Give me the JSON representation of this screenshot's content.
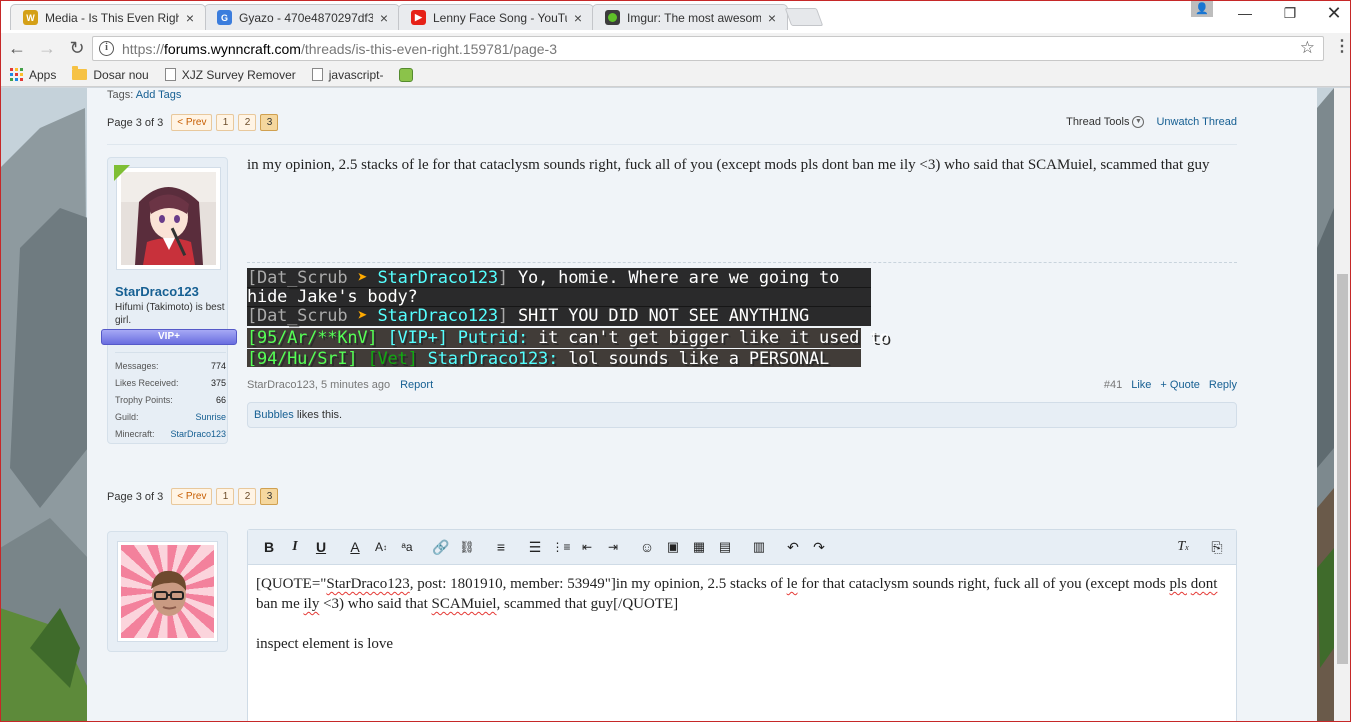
{
  "browser": {
    "tabs": [
      {
        "title": "Media - Is This Even Righ",
        "active": true,
        "favicon_color": "#d4a017"
      },
      {
        "title": "Gyazo - 470e4870297df3",
        "active": false,
        "favicon_color": "#3b7ddd"
      },
      {
        "title": "Lenny Face Song - YouTu",
        "active": false,
        "favicon_color": "#e62117"
      },
      {
        "title": "Imgur: The most awesom",
        "active": false,
        "favicon_color": "#5e9e34"
      }
    ],
    "url": {
      "scheme": "https://",
      "host": "forums.wynncraft.com",
      "path": "/threads/is-this-even-right.159781/page-3"
    },
    "bookmarks": [
      {
        "label": "Apps",
        "icon": "apps-grid-icon"
      },
      {
        "label": "Dosar nou",
        "icon": "folder-icon"
      },
      {
        "label": "XJZ Survey Remover",
        "icon": "document-icon"
      },
      {
        "label": "javascript-",
        "icon": "document-icon"
      },
      {
        "label": "",
        "icon": "extension-icon"
      }
    ]
  },
  "thread": {
    "tags_label": "Tags:",
    "add_tags": "Add Tags",
    "page_label": "Page 3 of 3",
    "prev_label": "< Prev",
    "pages": [
      "1",
      "2",
      "3"
    ],
    "current_page": "3",
    "thread_tools": "Thread Tools",
    "unwatch": "Unwatch Thread"
  },
  "post": {
    "username": "StarDraco123",
    "user_title": "Hifumi (Takimoto) is best girl.",
    "rank_badge": "VIP+",
    "stats": [
      {
        "label": "Messages:",
        "value": "774",
        "link": false
      },
      {
        "label": "Likes Received:",
        "value": "375",
        "link": false
      },
      {
        "label": "Trophy Points:",
        "value": "66",
        "link": false
      },
      {
        "label": "Guild:",
        "value": "Sunrise",
        "link": true
      },
      {
        "label": "Minecraft:",
        "value": "StarDraco123",
        "link": true
      }
    ],
    "text": "in my opinion, 2.5 stacks of le for that cataclysm sounds right, fuck all of you (except mods pls dont ban me ily <3) who said that SCAMuiel, scammed that guy",
    "chat_lines": {
      "l1_open": "[Dat_Scrub",
      "l1_arrow": "➤",
      "l1_target": "StarDraco123",
      "l1_close": "]",
      "l1_msg": "Yo, homie. Where are we going to",
      "l2_msg": "hide Jake's body?",
      "l3_open": "[Dat_Scrub",
      "l3_arrow": "➤",
      "l3_target": "StarDraco123",
      "l3_close": "]",
      "l3_msg": "SHIT YOU DID NOT SEE ANYTHING",
      "l4_tag": "[95/Ar/**KnV]",
      "l4_rank": "[VIP+]",
      "l4_name": "Putrid:",
      "l4_msg": "it can't get bigger like it used to",
      "l5_tag": "[94/Hu/SrI]",
      "l5_rank": "[Vet]",
      "l5_name": "StarDraco123:",
      "l5_msg": "lol sounds like a PERSONAL"
    },
    "meta_author": "StarDraco123",
    "meta_time": "5 minutes ago",
    "report": "Report",
    "post_number": "#41",
    "like": "Like",
    "quote": "+ Quote",
    "reply": "Reply",
    "likes_user": "Bubbles",
    "likes_suffix": "likes this."
  },
  "reply_editor": {
    "quote_prefix": "[QUOTE=\"",
    "quote_user": "StarDraco123",
    "quote_meta": ", post: 1801910, member: 53949\"]in my opinion, 2.5 stacks of",
    "w_le": "le",
    "quote_mid": "for that cataclysm sounds right, fuck all of you (except mods",
    "w_pls": "pls",
    "w_dont": "dont",
    "quote_ban": "ban me",
    "w_ily": "ily",
    "quote_who": "<3) who said that",
    "w_scamuiel": "SCAMuiel",
    "quote_end": ", scammed that guy[/QUOTE]",
    "line2": "inspect element is love"
  }
}
